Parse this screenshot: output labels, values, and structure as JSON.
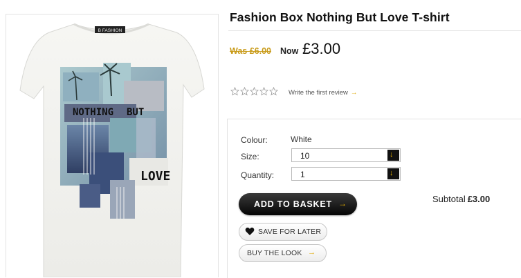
{
  "product": {
    "title": "Fashion Box Nothing But Love T-shirt",
    "image_brand_tag": "B FASHION",
    "print_words": [
      "NOTHING",
      "BUT",
      "LOVE"
    ]
  },
  "price": {
    "was": "Was £6.00",
    "now_label": "Now",
    "now_value": "£3.00"
  },
  "reviews": {
    "rating": 0,
    "max": 5,
    "link_text": "Write the first review",
    "arrow": "→"
  },
  "options": {
    "colour_label": "Colour:",
    "colour_value": "White",
    "size_label": "Size:",
    "size_value": "10",
    "quantity_label": "Quantity:",
    "quantity_value": "1",
    "dropdown_glyph": "↓"
  },
  "actions": {
    "basket_label": "ADD TO BASKET",
    "basket_arrow": "→",
    "save_label": "SAVE FOR LATER",
    "look_label": "BUY THE LOOK",
    "look_arrow": "→"
  },
  "subtotal": {
    "label": "Subtotal",
    "value": "£3.00"
  },
  "colors": {
    "was_price": "#c89a17",
    "accent_arrow": "#f0b800",
    "button_dark": "#111111"
  },
  "icons": {
    "star": "star-outline-icon",
    "heart": "heart-icon",
    "arrow": "arrow-right-icon",
    "dropdown": "arrow-down-icon"
  }
}
